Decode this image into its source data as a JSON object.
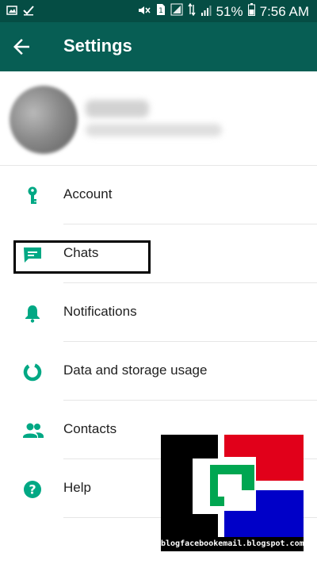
{
  "status_bar": {
    "battery_percent": "51%",
    "time": "7:56 AM",
    "left_icons": [
      "image-icon",
      "check-icon"
    ],
    "right_icons": [
      "mute-icon",
      "sim-icon",
      "signal-icon",
      "data-arrows-icon",
      "signal-icon",
      "battery-icon"
    ]
  },
  "toolbar": {
    "title": "Settings",
    "back_icon": "arrow-left-icon",
    "color": "#075e54"
  },
  "profile": {
    "name": "",
    "status": ""
  },
  "menu": {
    "accent_color": "#00a884",
    "items": [
      {
        "label": "Account",
        "icon": "key-icon"
      },
      {
        "label": "Chats",
        "icon": "chat-icon"
      },
      {
        "label": "Notifications",
        "icon": "bell-icon"
      },
      {
        "label": "Data and storage usage",
        "icon": "data-usage-icon"
      },
      {
        "label": "Contacts",
        "icon": "contacts-icon"
      },
      {
        "label": "Help",
        "icon": "help-icon"
      }
    ]
  },
  "watermark": {
    "caption": "blogfacebookemail.blogspot.com",
    "colors": [
      "#000000",
      "#e1001a",
      "#00a651",
      "#0000c8"
    ]
  }
}
